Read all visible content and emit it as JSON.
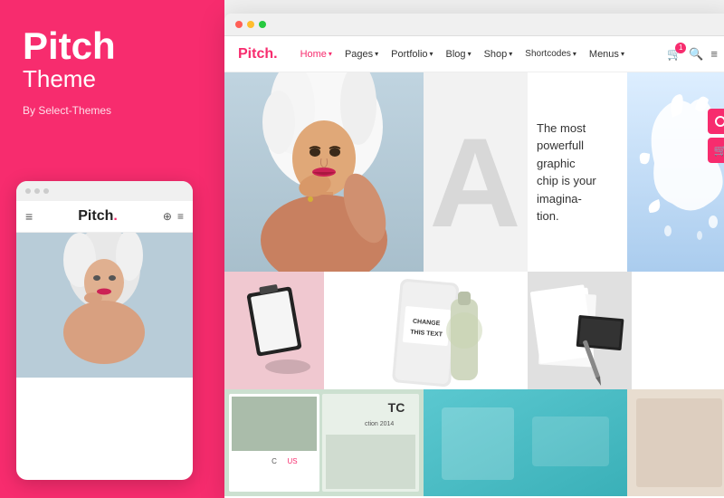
{
  "leftPanel": {
    "title": "Pitch",
    "subtitle": "Theme",
    "byLine": "By Select-Themes"
  },
  "mobileMockup": {
    "dots": [
      "●",
      "●",
      "●"
    ],
    "logo": "Pitch",
    "logoDot": ".",
    "navIcons": "⊕ ≡"
  },
  "browserChrome": {
    "dots": [
      "",
      "",
      ""
    ]
  },
  "browserNav": {
    "logo": "Pitch",
    "logoDot": ".",
    "items": [
      {
        "label": "Home",
        "hasArrow": true
      },
      {
        "label": "Pages",
        "hasArrow": true
      },
      {
        "label": "Portfolio",
        "hasArrow": true
      },
      {
        "label": "Blog",
        "hasArrow": true
      },
      {
        "label": "Shop",
        "hasArrow": true
      },
      {
        "label": "Shortcodes",
        "hasArrow": true
      },
      {
        "label": "Menus",
        "hasArrow": true
      }
    ]
  },
  "contentGrid": {
    "textCell": {
      "line1": "The most",
      "line2": "powerfull",
      "line3": "graphic",
      "line4": "chip is your",
      "line5": "imagina-",
      "line6": "tion."
    },
    "productLabel": "CHANGE\nTHIS TEXT"
  },
  "floatingButtons": {
    "btn1": "○",
    "btn2": "🛒"
  }
}
